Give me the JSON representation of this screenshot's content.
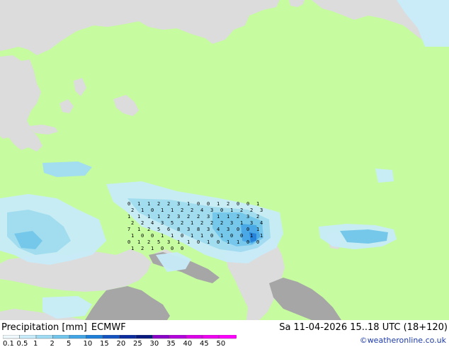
{
  "footer": {
    "title": "Precipitation [mm]",
    "model": "ECMWF",
    "datetime": "Sa 11-04-2026 15..18 UTC (18+120)",
    "credit": "©weatheronline.co.uk"
  },
  "legend": {
    "labels": [
      "0.1",
      "0.5",
      "1",
      "2",
      "5",
      "10",
      "15",
      "20",
      "25",
      "30",
      "35",
      "40",
      "45",
      "50"
    ],
    "colors": [
      "#eef8fd",
      "#c8ecf9",
      "#a0dcf4",
      "#72c6ee",
      "#42a6e6",
      "#1e7fd8",
      "#1454c0",
      "#0c2da0",
      "#081a80",
      "#8a00c8",
      "#b400dc",
      "#dc00e8",
      "#f000f0",
      "#ff00ff"
    ]
  },
  "map": {
    "land_color": "#c6fba0",
    "sea_color": "#dcdcdc",
    "mountain_color": "#a6a6a6"
  },
  "precip_labels": [
    "0",
    "1",
    "1",
    "2",
    "2",
    "3",
    "1",
    "0",
    "0",
    "1",
    "2",
    "0",
    "0",
    "1",
    "2",
    "1",
    "0",
    "1",
    "1",
    "2",
    "2",
    "4",
    "3",
    "0",
    "1",
    "2",
    "2",
    "3",
    "1",
    "1",
    "1",
    "1",
    "2",
    "3",
    "2",
    "2",
    "3",
    "1",
    "1",
    "2",
    "3",
    "2",
    "2",
    "2",
    "4",
    "3",
    "5",
    "2",
    "1",
    "2",
    "2",
    "2",
    "3",
    "1",
    "3",
    "4",
    "7",
    "1",
    "2",
    "5",
    "6",
    "8",
    "3",
    "8",
    "3",
    "4",
    "3",
    "0",
    "0",
    "1",
    "1",
    "0",
    "0",
    "1",
    "1",
    "0",
    "1",
    "1",
    "0",
    "1",
    "0",
    "0",
    "1",
    "1",
    "0",
    "1",
    "2",
    "5",
    "3",
    "1",
    "1",
    "0",
    "1",
    "0",
    "1",
    "1",
    "0",
    "0",
    "1",
    "2",
    "1",
    "0",
    "0",
    "0"
  ]
}
